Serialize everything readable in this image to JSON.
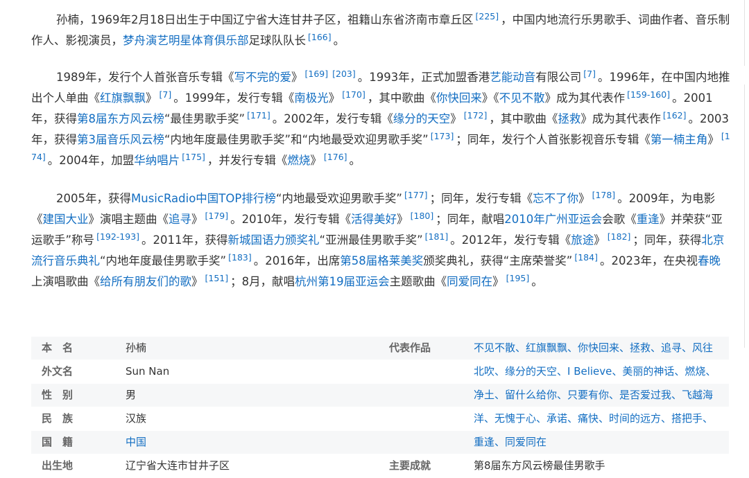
{
  "paragraphs": {
    "p1": [
      {
        "t": "孙楠，1969年2月18日出生于中国辽宁省大连甘井子区，祖籍山东省济南市章丘区"
      },
      {
        "r": "[225]"
      },
      {
        "t": "，中国内地流行乐男歌手、词曲作者、音乐制作人、影视演员，"
      },
      {
        "l": "梦舟演艺明星体育俱乐部"
      },
      {
        "t": "足球队队长"
      },
      {
        "r": "[166]"
      },
      {
        "t": "。"
      }
    ],
    "p2": [
      {
        "t": "1989年，发行个人首张音乐专辑《"
      },
      {
        "l": "写不完的爱"
      },
      {
        "t": "》"
      },
      {
        "r": "[169]"
      },
      {
        "r": "[203]"
      },
      {
        "t": "。1993年，正式加盟香港"
      },
      {
        "l": "艺能动音"
      },
      {
        "t": "有限公司"
      },
      {
        "r": "[7]"
      },
      {
        "t": "。1996年，在中国内地推出个人单曲《"
      },
      {
        "l": "红旗飘飘"
      },
      {
        "t": "》"
      },
      {
        "r": "[7]"
      },
      {
        "t": "。1999年，发行专辑《"
      },
      {
        "l": "南极光"
      },
      {
        "t": "》"
      },
      {
        "r": "[170]"
      },
      {
        "t": "，其中歌曲《"
      },
      {
        "l": "你快回来"
      },
      {
        "t": "》《"
      },
      {
        "l": "不见不散"
      },
      {
        "t": "》成为其代表作"
      },
      {
        "r": "[159-160]"
      },
      {
        "t": "。2001年，获得"
      },
      {
        "l": "第8届东方风云榜"
      },
      {
        "t": "“最佳男歌手奖”"
      },
      {
        "r": "[171]"
      },
      {
        "t": "。2002年，发行专辑《"
      },
      {
        "l": "缘分的天空"
      },
      {
        "t": "》"
      },
      {
        "r": "[172]"
      },
      {
        "t": "，其中歌曲《"
      },
      {
        "l": "拯救"
      },
      {
        "t": "》成为其代表作"
      },
      {
        "r": "[162]"
      },
      {
        "t": "。2003年，获得"
      },
      {
        "l": "第3届音乐风云榜"
      },
      {
        "t": "“内地年度最佳男歌手奖”和“内地最受欢迎男歌手奖”"
      },
      {
        "r": "[173]"
      },
      {
        "t": "；同年，发行个人首张影视音乐专辑《"
      },
      {
        "l": "第一楠主角"
      },
      {
        "t": "》"
      },
      {
        "r": "[174]"
      },
      {
        "t": "。2004年，加盟"
      },
      {
        "l": "华纳唱片"
      },
      {
        "r": "[175]"
      },
      {
        "t": "，并发行专辑《"
      },
      {
        "l": "燃烧"
      },
      {
        "t": "》"
      },
      {
        "r": "[176]"
      },
      {
        "t": "。"
      }
    ],
    "p3": [
      {
        "t": "2005年，获得"
      },
      {
        "l": "MusicRadio中国TOP排行榜"
      },
      {
        "t": "“内地最受欢迎男歌手奖”"
      },
      {
        "r": "[177]"
      },
      {
        "t": "；同年，发行专辑《"
      },
      {
        "l": "忘不了你"
      },
      {
        "t": "》"
      },
      {
        "r": "[178]"
      },
      {
        "t": "。2009年，为电影《"
      },
      {
        "l": "建国大业"
      },
      {
        "t": "》演唱主题曲《"
      },
      {
        "l": "追寻"
      },
      {
        "t": "》"
      },
      {
        "r": "[179]"
      },
      {
        "t": "。2010年，发行专辑《"
      },
      {
        "l": "活得美好"
      },
      {
        "t": "》"
      },
      {
        "r": "[180]"
      },
      {
        "t": "；同年，献唱"
      },
      {
        "l": "2010年广州亚运会"
      },
      {
        "t": "会歌《"
      },
      {
        "l": "重逢"
      },
      {
        "t": "》并荣获“亚运歌手”称号"
      },
      {
        "r": "[192-193]"
      },
      {
        "t": "。2011年，获得"
      },
      {
        "l": "新城国语力颁奖礼"
      },
      {
        "t": "“亚洲最佳男歌手奖”"
      },
      {
        "r": "[181]"
      },
      {
        "t": "。2012年，发行专辑《"
      },
      {
        "l": "旅途"
      },
      {
        "t": "》"
      },
      {
        "r": "[182]"
      },
      {
        "t": "；同年，获得"
      },
      {
        "l": "北京流行音乐典礼"
      },
      {
        "t": "“内地年度最佳男歌手奖”"
      },
      {
        "r": "[183]"
      },
      {
        "t": "。2016年，出席"
      },
      {
        "l": "第58届格莱美奖"
      },
      {
        "t": "颁奖典礼，获得“主席荣誉奖”"
      },
      {
        "r": "[184]"
      },
      {
        "t": "。2023年，在央视"
      },
      {
        "l": "春晚"
      },
      {
        "t": "上演唱歌曲《"
      },
      {
        "l": "给所有朋友们的歌"
      },
      {
        "t": "》"
      },
      {
        "r": "[151]"
      },
      {
        "t": "；8月，献唱"
      },
      {
        "l": "杭州第19届亚运会"
      },
      {
        "t": "主题歌曲《"
      },
      {
        "l": "同爱同在"
      },
      {
        "t": "》"
      },
      {
        "r": "[195]"
      },
      {
        "t": "。"
      }
    ]
  },
  "infobox": {
    "left": [
      {
        "label": "本　名",
        "value": "孙楠",
        "link": false
      },
      {
        "label": "外文名",
        "value": "Sun Nan",
        "link": false
      },
      {
        "label": "性　别",
        "value": "男",
        "link": false
      },
      {
        "label": "民　族",
        "value": "汉族",
        "link": false
      },
      {
        "label": "国　籍",
        "value": "中国",
        "link": true
      },
      {
        "label": "出生地",
        "value": "辽宁省大连市甘井子区",
        "link": false
      }
    ],
    "right_label_works": "代表作品",
    "right_works_lines": [
      "不见不散、红旗飘飘、你快回来、拯救、追寻、风往",
      "北吹、缘分的天空、I Believe、美丽的神话、燃烧、",
      "净土、留什么给你、只要有你、是否爱过我、飞越海",
      "洋、无愧于心、承诺、痛快、时间的远方、搭把手、",
      "重逢、同爱同在"
    ],
    "right_label_achievement": "主要成就",
    "right_achievement": "第8届东方风云榜最佳男歌手"
  }
}
